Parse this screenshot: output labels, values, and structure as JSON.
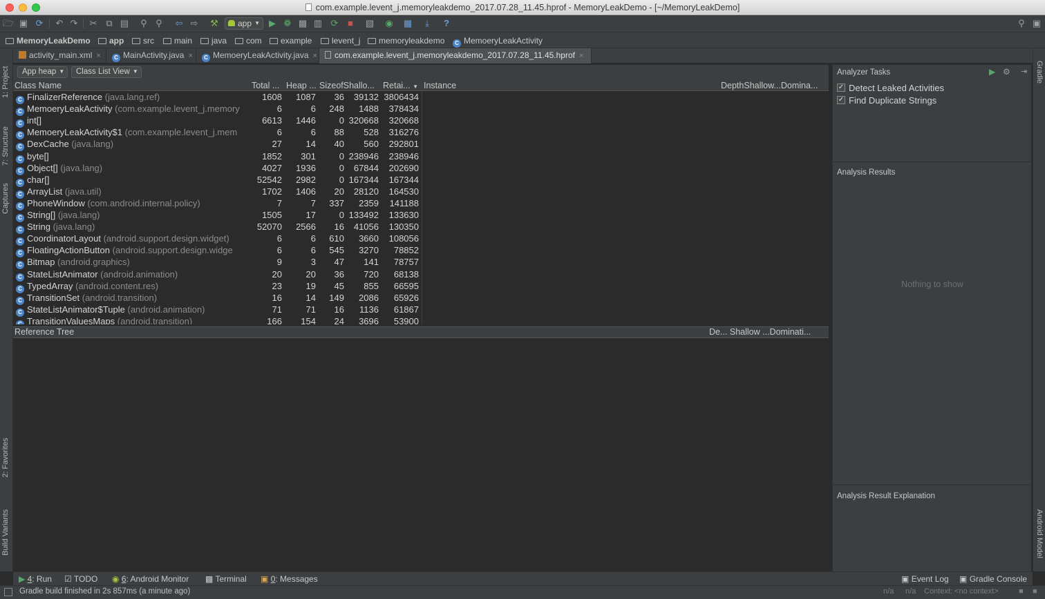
{
  "window": {
    "title": "com.example.levent_j.memoryleakdemo_2017.07.28_11.45.hprof - MemoryLeakDemo - [~/MemoryLeakDemo]",
    "traffic_colors": [
      "#fc605b",
      "#fdbc40",
      "#34c84a"
    ]
  },
  "toolbar": {
    "run_config": "app",
    "help": "?"
  },
  "breadcrumb": [
    "MemoryLeakDemo",
    "app",
    "src",
    "main",
    "java",
    "com",
    "example",
    "levent_j",
    "memoryleakdemo",
    "MemoeryLeakActivity"
  ],
  "tabs": [
    {
      "label": "activity_main.xml",
      "icon": "xml-icon"
    },
    {
      "label": "MainActivity.java",
      "icon": "class-icon"
    },
    {
      "label": "MemoeryLeakActivity.java",
      "icon": "class-icon"
    },
    {
      "label": "com.example.levent_j.memoryleakdemo_2017.07.28_11.45.hprof",
      "icon": "file-icon",
      "active": true
    }
  ],
  "close_glyph": "×",
  "heap": {
    "heap_select": "App heap",
    "view_select": "Class List View"
  },
  "class_table": {
    "headers": [
      "Class Name",
      "Total ...",
      "Heap ...",
      "SizeofShallo...",
      "Retai..."
    ],
    "rows": [
      {
        "name": "FinalizerReference",
        "pkg": "(java.lang.ref)",
        "total": "1608",
        "heap": "1087",
        "size": "36",
        "shallow": "39132",
        "retained": "3806434"
      },
      {
        "name": "MemoeryLeakActivity",
        "pkg": "(com.example.levent_j.memory",
        "total": "6",
        "heap": "6",
        "size": "248",
        "shallow": "1488",
        "retained": "378434"
      },
      {
        "name": "int[]",
        "pkg": "",
        "total": "6613",
        "heap": "1446",
        "size": "0",
        "shallow": "320668",
        "retained": "320668"
      },
      {
        "name": "MemoeryLeakActivity$1",
        "pkg": "(com.example.levent_j.mem",
        "total": "6",
        "heap": "6",
        "size": "88",
        "shallow": "528",
        "retained": "316276"
      },
      {
        "name": "DexCache",
        "pkg": "(java.lang)",
        "total": "27",
        "heap": "14",
        "size": "40",
        "shallow": "560",
        "retained": "292801"
      },
      {
        "name": "byte[]",
        "pkg": "",
        "total": "1852",
        "heap": "301",
        "size": "0",
        "shallow": "238946",
        "retained": "238946"
      },
      {
        "name": "Object[]",
        "pkg": "(java.lang)",
        "total": "4027",
        "heap": "1936",
        "size": "0",
        "shallow": "67844",
        "retained": "202690"
      },
      {
        "name": "char[]",
        "pkg": "",
        "total": "52542",
        "heap": "2982",
        "size": "0",
        "shallow": "167344",
        "retained": "167344"
      },
      {
        "name": "ArrayList",
        "pkg": "(java.util)",
        "total": "1702",
        "heap": "1406",
        "size": "20",
        "shallow": "28120",
        "retained": "164530"
      },
      {
        "name": "PhoneWindow",
        "pkg": "(com.android.internal.policy)",
        "total": "7",
        "heap": "7",
        "size": "337",
        "shallow": "2359",
        "retained": "141188"
      },
      {
        "name": "String[]",
        "pkg": "(java.lang)",
        "total": "1505",
        "heap": "17",
        "size": "0",
        "shallow": "133492",
        "retained": "133630"
      },
      {
        "name": "String",
        "pkg": "(java.lang)",
        "total": "52070",
        "heap": "2566",
        "size": "16",
        "shallow": "41056",
        "retained": "130350"
      },
      {
        "name": "CoordinatorLayout",
        "pkg": "(android.support.design.widget)",
        "total": "6",
        "heap": "6",
        "size": "610",
        "shallow": "3660",
        "retained": "108056"
      },
      {
        "name": "FloatingActionButton",
        "pkg": "(android.support.design.widge",
        "total": "6",
        "heap": "6",
        "size": "545",
        "shallow": "3270",
        "retained": "78852"
      },
      {
        "name": "Bitmap",
        "pkg": "(android.graphics)",
        "total": "9",
        "heap": "3",
        "size": "47",
        "shallow": "141",
        "retained": "78757"
      },
      {
        "name": "StateListAnimator",
        "pkg": "(android.animation)",
        "total": "20",
        "heap": "20",
        "size": "36",
        "shallow": "720",
        "retained": "68138"
      },
      {
        "name": "TypedArray",
        "pkg": "(android.content.res)",
        "total": "23",
        "heap": "19",
        "size": "45",
        "shallow": "855",
        "retained": "66595"
      },
      {
        "name": "TransitionSet",
        "pkg": "(android.transition)",
        "total": "16",
        "heap": "14",
        "size": "149",
        "shallow": "2086",
        "retained": "65926"
      },
      {
        "name": "StateListAnimator$Tuple",
        "pkg": "(android.animation)",
        "total": "71",
        "heap": "71",
        "size": "16",
        "shallow": "1136",
        "retained": "61867"
      },
      {
        "name": "TransitionValuesMaps",
        "pkg": "(android.transition)",
        "total": "166",
        "heap": "154",
        "size": "24",
        "shallow": "3696",
        "retained": "53900"
      }
    ]
  },
  "instance_pane": {
    "title": "Instance",
    "col_header": "DepthShallow...Domina..."
  },
  "reference_tree": {
    "title": "Reference Tree",
    "col_header": "De... Shallow ...Dominati..."
  },
  "analyzer": {
    "tasks_title": "Analyzer Tasks",
    "tasks": [
      {
        "label": "Detect Leaked Activities",
        "checked": true
      },
      {
        "label": "Find Duplicate Strings",
        "checked": true
      }
    ],
    "results_title": "Analysis Results",
    "empty_text": "Nothing to show",
    "explanation_title": "Analysis Result Explanation"
  },
  "left_strip": [
    "1: Project",
    "7: Structure",
    "Captures",
    "2: Favorites",
    "Build Variants"
  ],
  "right_strip": [
    "Gradle",
    "Android Model"
  ],
  "bottom_tools": {
    "run_key": "4",
    "run_label": ": Run",
    "todo": "TODO",
    "monitor_key": "6",
    "monitor_label": ": Android Monitor",
    "terminal": "Terminal",
    "messages_key": "0",
    "messages_label": ": Messages",
    "event_log": "Event Log",
    "gradle_console": "Gradle Console"
  },
  "status": {
    "message": "Gradle build finished in 2s 857ms (a minute ago)",
    "pos1": "n/a",
    "pos2": "n/a",
    "context": "Context: <no context>"
  }
}
